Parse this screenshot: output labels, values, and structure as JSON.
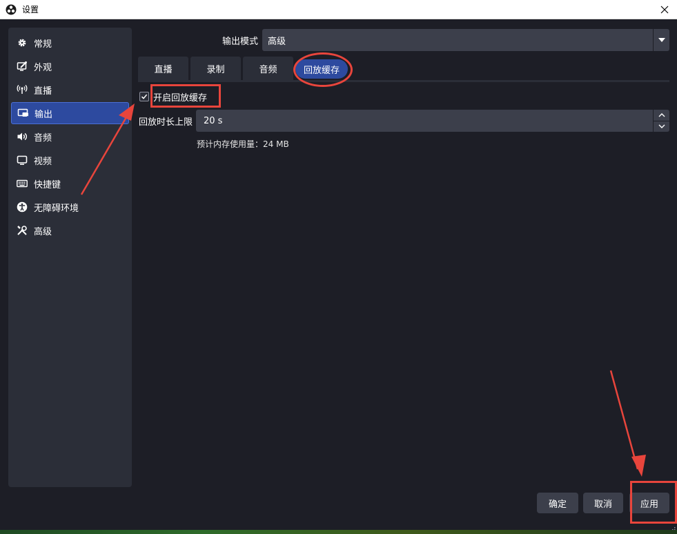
{
  "window": {
    "title": "设置",
    "close_icon": "close-icon"
  },
  "sidebar": {
    "items": [
      {
        "label": "常规",
        "icon": "gear-icon",
        "active": false
      },
      {
        "label": "外观",
        "icon": "appearance-icon",
        "active": false
      },
      {
        "label": "直播",
        "icon": "broadcast-icon",
        "active": false
      },
      {
        "label": "输出",
        "icon": "output-icon",
        "active": true
      },
      {
        "label": "音频",
        "icon": "speaker-icon",
        "active": false
      },
      {
        "label": "视频",
        "icon": "monitor-icon",
        "active": false
      },
      {
        "label": "快捷键",
        "icon": "keyboard-icon",
        "active": false
      },
      {
        "label": "无障碍环境",
        "icon": "accessibility-icon",
        "active": false
      },
      {
        "label": "高级",
        "icon": "tools-icon",
        "active": false
      }
    ]
  },
  "output_mode": {
    "label": "输出模式",
    "value": "高级"
  },
  "tabs": [
    {
      "label": "直播",
      "active": false
    },
    {
      "label": "录制",
      "active": false
    },
    {
      "label": "音频",
      "active": false
    },
    {
      "label": "回放缓存",
      "active": true
    }
  ],
  "replay": {
    "enable_label": "开启回放缓存",
    "enabled": true,
    "duration_label": "回放时长上限",
    "duration_value": "20 s",
    "memory_estimate": "预计内存使用量：24 MB"
  },
  "footer": {
    "ok_label": "确定",
    "cancel_label": "取消",
    "apply_label": "应用"
  },
  "colors": {
    "accent": "#2d4a9f",
    "annotation": "#e8453c",
    "background": "#1d1e26",
    "panel": "#2b2e38",
    "field": "#3c3f4b"
  }
}
